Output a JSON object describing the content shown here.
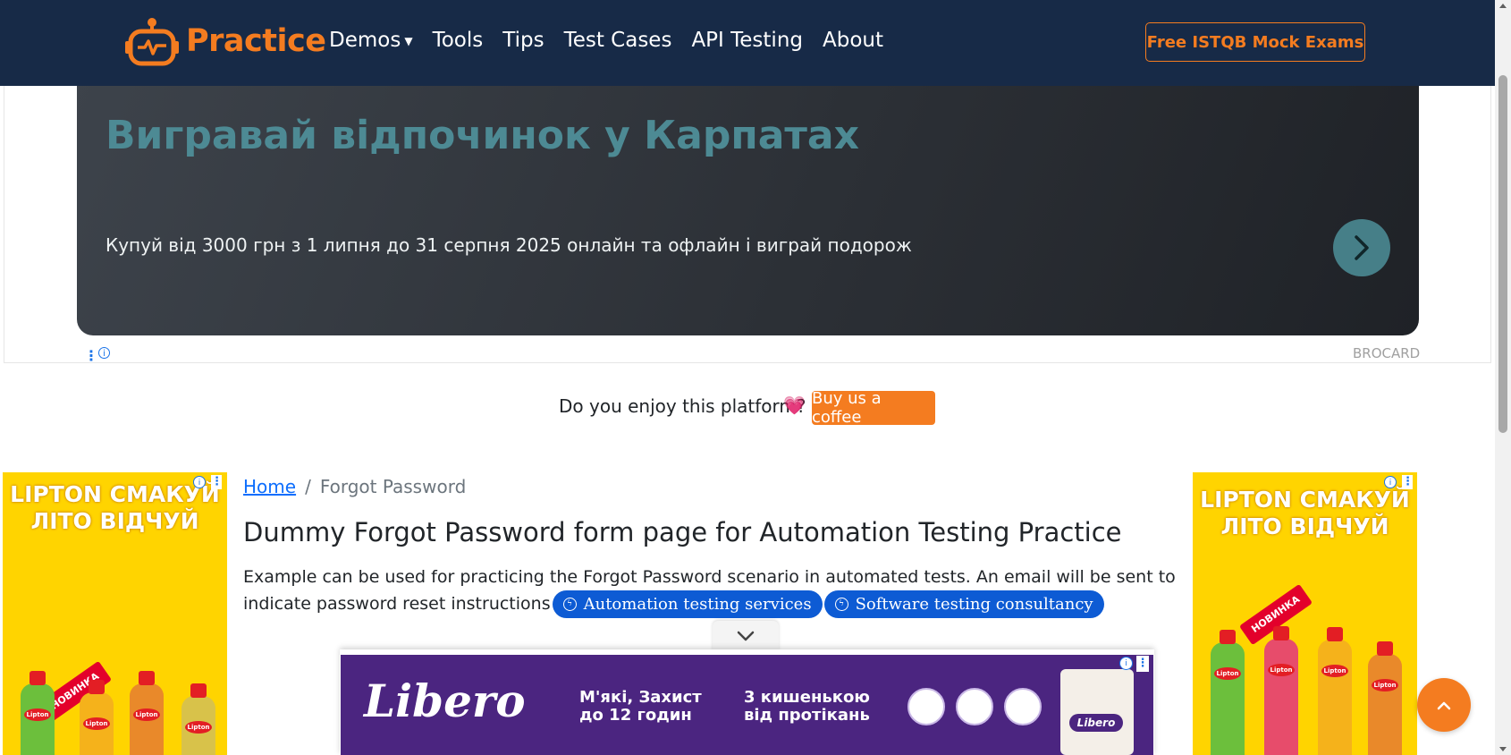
{
  "navbar": {
    "brand": "Practice",
    "links": [
      "Demos",
      "Tools",
      "Tips",
      "Test Cases",
      "API Testing",
      "About"
    ],
    "cta": "Free ISTQB Mock Exams",
    "colors": {
      "background": "#172a47",
      "accent": "#f47c20"
    }
  },
  "top_ad": {
    "title": "Вигравай відпочинок у Карпатах",
    "text": "Купуй від 3000 грн з 1 липня до 31 серпня 2025 онлайн та офлайн і виграй подорож",
    "advertiser": "BROCARD",
    "button_icon": "chevron-right-icon"
  },
  "coffee": {
    "text": "Do you enjoy this platform?",
    "heart": "💗",
    "button": "Buy us a coffee"
  },
  "side_ad": {
    "line1": "LIPTON СМАКУЙ",
    "line2": "ЛІТО ВІДЧУЙ",
    "badge": "НОВИНКА",
    "bottle_label": "Lipton"
  },
  "breadcrumb": {
    "home": "Home",
    "separator": "/",
    "current": "Forgot Password"
  },
  "main": {
    "title": "Dummy Forgot Password form page for Automation Testing Practice",
    "description": "Example can be used for practicing the Forgot Password scenario in automated tests. An email will be sent to indicate password reset instructions",
    "pills": [
      "Automation testing services",
      "Software testing consultancy"
    ]
  },
  "banner_ad": {
    "brand": "Libero",
    "text1_line1": "М'які, Захист",
    "text1_line2": "до 12 годин",
    "text2_line1": "3 кишенькою",
    "text2_line2": "від протікань",
    "pack_logo": "Libero"
  }
}
